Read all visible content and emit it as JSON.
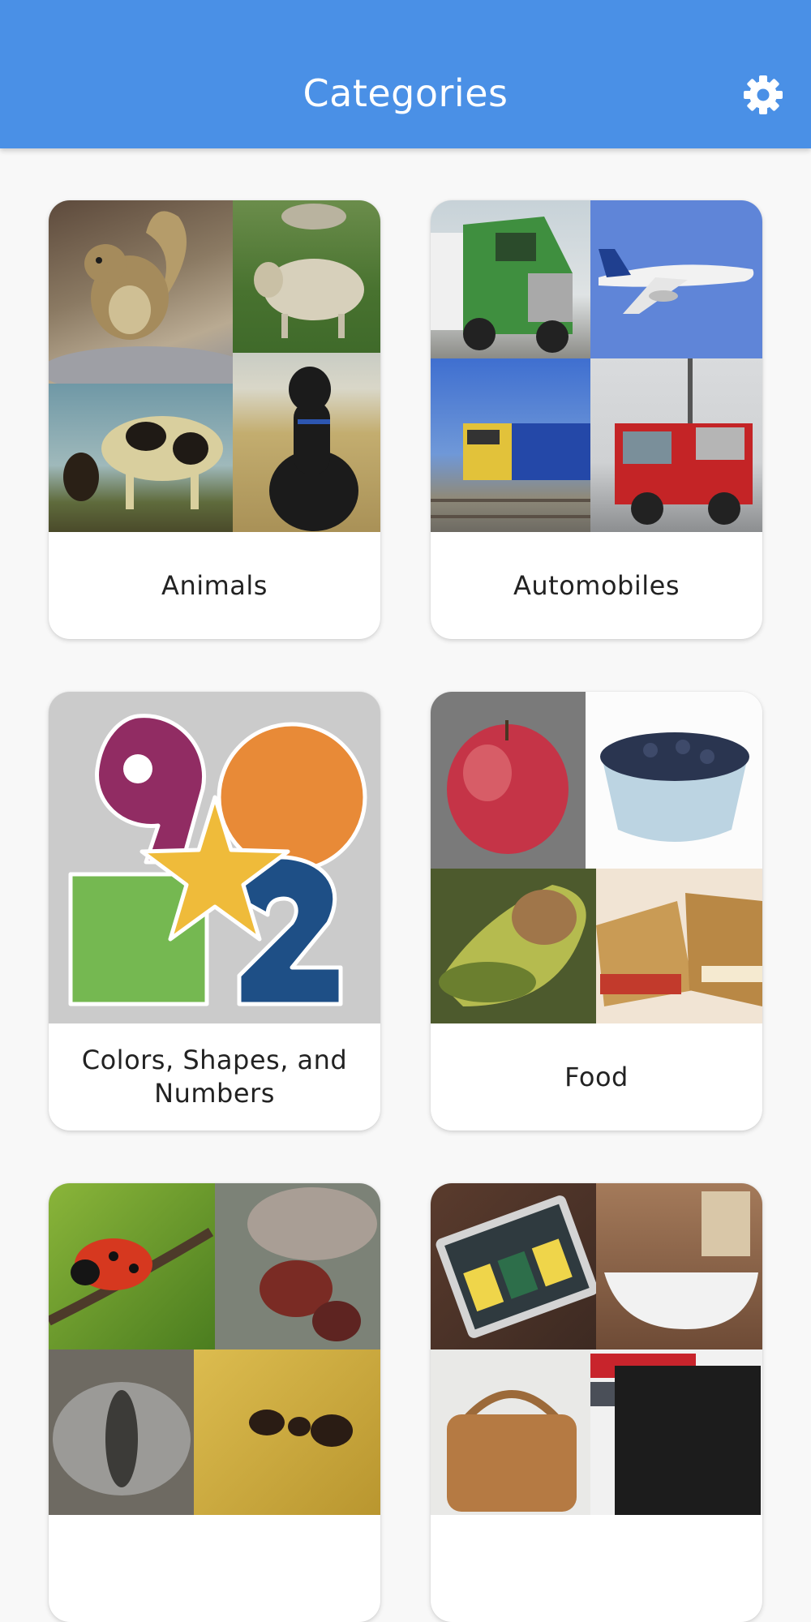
{
  "app_bar": {
    "title": "Categories",
    "settings_icon": "gear-icon"
  },
  "categories": [
    {
      "label": "Animals",
      "thumbnail": [
        "squirrel",
        "sheep",
        "cow",
        "black-dog"
      ]
    },
    {
      "label": "Automobiles",
      "thumbnail": [
        "green-truck",
        "airplane",
        "train",
        "fire-truck"
      ]
    },
    {
      "label": "Colors, Shapes, and Numbers",
      "thumbnail": [
        "number-9",
        "orange-circle",
        "yellow-star",
        "green-square",
        "number-2"
      ]
    },
    {
      "label": "Food",
      "thumbnail": [
        "apple",
        "blueberries",
        "avocado",
        "grilled-cheese"
      ]
    },
    {
      "label": "",
      "thumbnail": [
        "ladybug",
        "hornet",
        "moth",
        "ant"
      ]
    },
    {
      "label": "",
      "thumbnail": [
        "tablet",
        "bathtub",
        "handbag",
        "wallet"
      ]
    }
  ],
  "colors": {
    "app_bar": "#4a90e6",
    "background": "#f8f8f8"
  }
}
